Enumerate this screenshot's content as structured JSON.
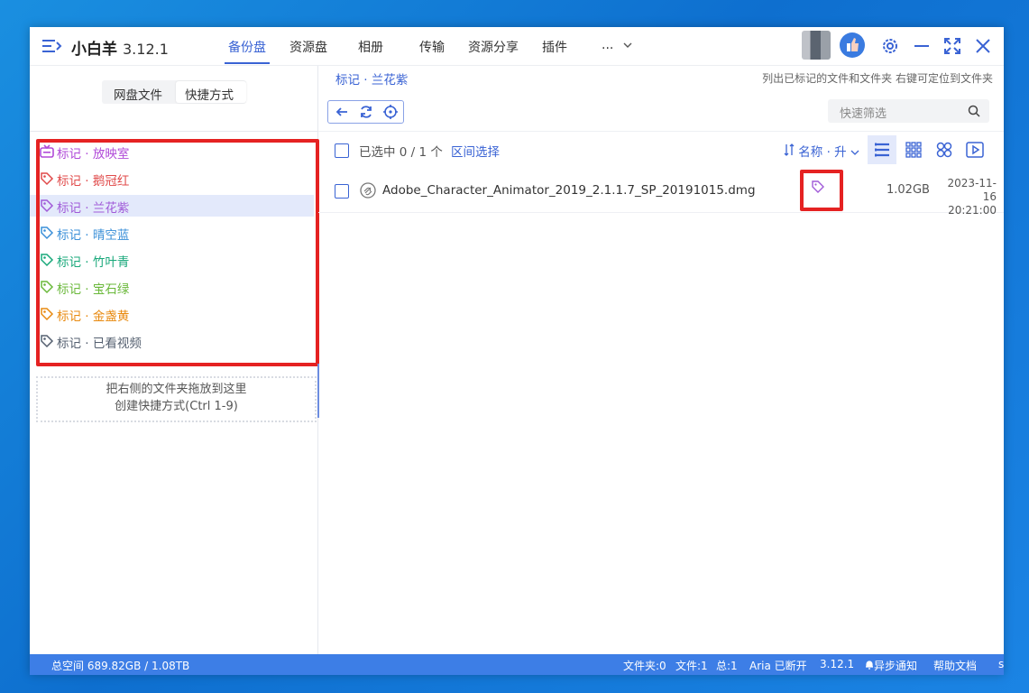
{
  "app": {
    "name": "小白羊",
    "version": "3.12.1"
  },
  "tabs": [
    {
      "label": "备份盘",
      "active": true
    },
    {
      "label": "资源盘"
    },
    {
      "label": "相册"
    },
    {
      "label": "传输"
    },
    {
      "label": "资源分享"
    },
    {
      "label": "插件"
    },
    {
      "label": "..."
    }
  ],
  "left": {
    "segments": [
      "网盘文件",
      "快捷方式"
    ],
    "shortcuts": [
      {
        "label": "标记 · 放映室",
        "color": "#b04ad8"
      },
      {
        "label": "标记 · 鹅冠红",
        "color": "#e04a4a"
      },
      {
        "label": "标记 · 兰花紫",
        "color": "#a05ad8",
        "selected": true
      },
      {
        "label": "标记 · 晴空蓝",
        "color": "#3a8fd8"
      },
      {
        "label": "标记 · 竹叶青",
        "color": "#18a87a"
      },
      {
        "label": "标记 · 宝石绿",
        "color": "#6ab83a"
      },
      {
        "label": "标记 · 金盏黄",
        "color": "#e88a10"
      },
      {
        "label": "标记 · 已看视频",
        "color": "#556070"
      }
    ],
    "drop_zone": [
      "把右侧的文件夹拖放到这里",
      "创建快捷方式(Ctrl 1-9)"
    ]
  },
  "main": {
    "breadcrumb": "标记 · 兰花紫",
    "hint": "列出已标记的文件和文件夹 右键可定位到文件夹",
    "search_placeholder": "快速筛选",
    "selection": "已选中 0 / 1 个",
    "range_select": "区间选择",
    "sort_label": "名称 · 升",
    "files": [
      {
        "name": "Adobe_Character_Animator_2019_2.1.1.7_SP_20191015.dmg",
        "size": "1.02GB",
        "date": "2023-11-16",
        "time": "20:21:00"
      }
    ]
  },
  "status": {
    "space": "总空间 689.82GB / 1.08TB",
    "folders": "文件夹:0",
    "files": "文件:1",
    "total": "总:1",
    "aria": "Aria 已断开",
    "version": "3.12.1",
    "notify": "异步通知",
    "help": "帮助文档",
    "extra": "s"
  },
  "colors": {
    "accent": "#3a63d4",
    "status_bar": "#3d7ee6",
    "highlight": "#e52222"
  }
}
